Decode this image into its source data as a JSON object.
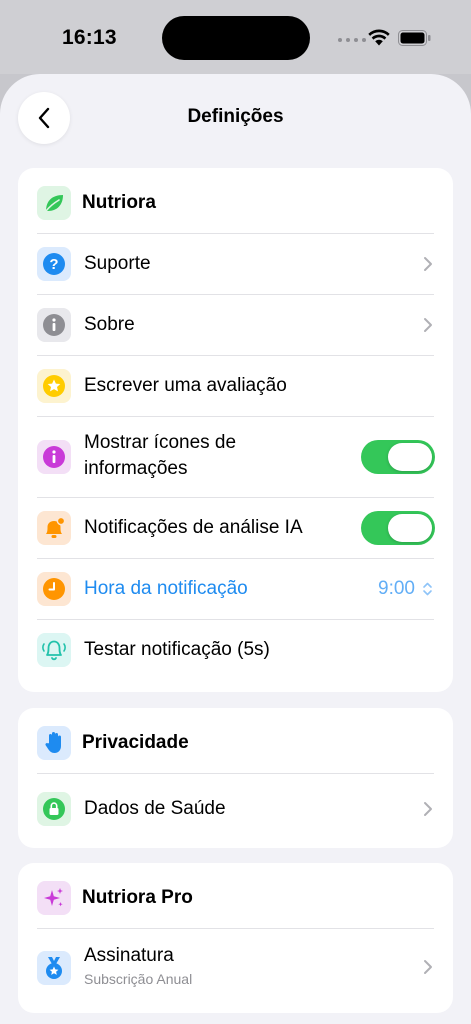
{
  "status_bar": {
    "time": "16:13"
  },
  "nav": {
    "title": "Definições"
  },
  "section_app": {
    "header": "Nutriora",
    "items": [
      {
        "label": "Suporte"
      },
      {
        "label": "Sobre"
      },
      {
        "label": "Escrever uma avaliação"
      },
      {
        "label_line1": "Mostrar ícones de",
        "label_line2": "informações",
        "toggle_on": true
      },
      {
        "label": "Notificações de análise IA",
        "toggle_on": true
      },
      {
        "label": "Hora da notificação",
        "value": "9:00"
      },
      {
        "label": "Testar notificação (5s)"
      }
    ]
  },
  "section_privacy": {
    "header": "Privacidade",
    "items": [
      {
        "label": "Dados de Saúde"
      }
    ]
  },
  "section_pro": {
    "header": "Nutriora Pro",
    "items": [
      {
        "label": "Assinatura",
        "sublabel": "Subscrição Anual"
      }
    ]
  },
  "colors": {
    "accent_blue": "#1e8bf0",
    "toggle_green": "#34c759",
    "orange": "#ff9500",
    "purple": "#c93ad8"
  }
}
